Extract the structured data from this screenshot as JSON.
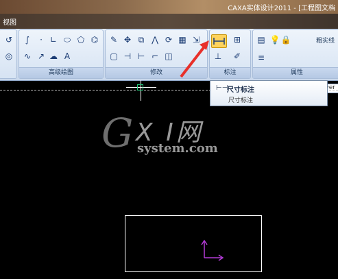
{
  "window": {
    "title": "CAXA实体设计2011 - [工程图文档"
  },
  "tabs": {
    "view": "视图"
  },
  "ribbon": {
    "groups": {
      "advanced_draw": "高级绘图",
      "modify": "修改",
      "annotate": "标注",
      "properties": "属性"
    },
    "icons": [
      "undo-icon",
      "circle-icon",
      "spline-icon",
      "point-icon",
      "angle-icon",
      "ellipse-icon",
      "polygon-icon",
      "hatch-icon",
      "wave-icon",
      "arrow-icon",
      "cloud-icon",
      "text-icon",
      "eraser-icon",
      "move-icon",
      "copy-icon",
      "mirror-icon",
      "rotate-icon",
      "array-icon",
      "stretch-icon",
      "trim-icon",
      "extend-icon",
      "break-icon",
      "fillet-icon",
      "chamfer-icon",
      "dimension-icon",
      "text-style-icon",
      "coordinate-icon",
      "edit-icon",
      "layer-icon",
      "lightbulb-icon",
      "lock-icon"
    ],
    "line_current": "粗实线",
    "linetype_value": "ByLayer"
  },
  "tooltip": {
    "title": "尺寸标注",
    "description": "尺寸标注"
  },
  "watermark": {
    "big_g": "G",
    "xi": "X I",
    "net": "网",
    "sub": "system.com"
  },
  "colors": {
    "canvas": "#000000",
    "ribbon": "#dfe9f6",
    "accent": "#ffd35c",
    "arrow": "#e8302a",
    "ucs": "#b23bd6"
  }
}
